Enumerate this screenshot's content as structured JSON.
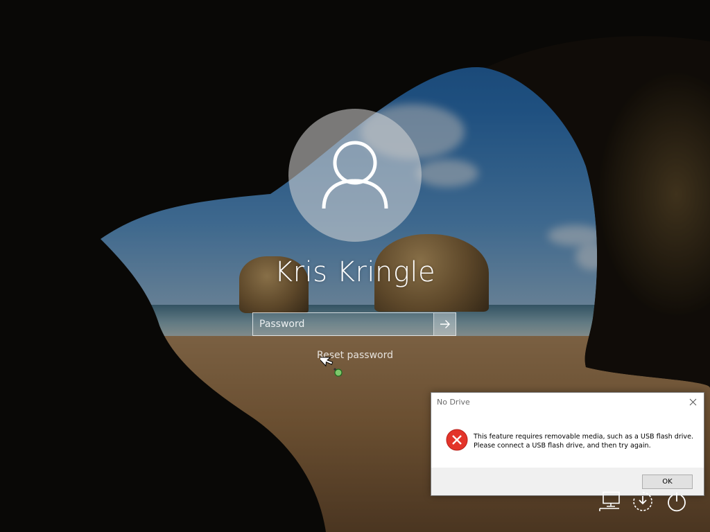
{
  "login": {
    "user_name": "Kris Kringle",
    "password_placeholder": "Password",
    "reset_password_label": "Reset password"
  },
  "dialog": {
    "title": "No Drive",
    "message": "This feature requires removable media, such as a USB flash drive. Please connect a USB flash drive, and then try again.",
    "ok_label": "OK"
  },
  "system_icons": [
    "network-icon",
    "ease-of-access-icon",
    "power-icon"
  ],
  "colors": {
    "error_red": "#e3342a",
    "dialog_background": "#ffffff",
    "dialog_footer": "#f0f0f0"
  }
}
